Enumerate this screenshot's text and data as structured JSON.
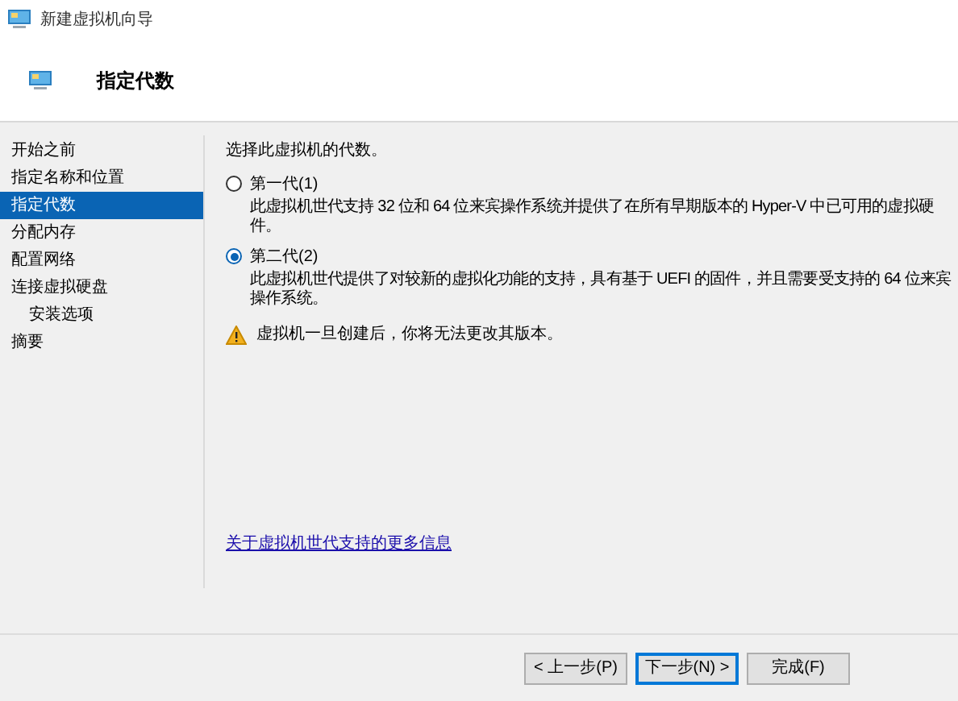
{
  "window": {
    "title": "新建虚拟机向导"
  },
  "header": {
    "title": "指定代数"
  },
  "sidebar": {
    "items": [
      {
        "label": "开始之前",
        "selected": false
      },
      {
        "label": "指定名称和位置",
        "selected": false
      },
      {
        "label": "指定代数",
        "selected": true
      },
      {
        "label": "分配内存",
        "selected": false
      },
      {
        "label": "配置网络",
        "selected": false
      },
      {
        "label": "连接虚拟硬盘",
        "selected": false,
        "children": [
          {
            "label": "安装选项",
            "selected": false
          }
        ]
      },
      {
        "label": "摘要",
        "selected": false
      }
    ]
  },
  "content": {
    "prompt": "选择此虚拟机的代数。",
    "options": [
      {
        "label": "第一代(1)",
        "selected": false,
        "description": "此虚拟机世代支持 32 位和 64 位来宾操作系统并提供了在所有早期版本的 Hyper-V 中已可用的虚拟硬件。"
      },
      {
        "label": "第二代(2)",
        "selected": true,
        "description": "此虚拟机世代提供了对较新的虚拟化功能的支持，具有基于 UEFI 的固件，并且需要受支持的 64 位来宾操作系统。"
      }
    ],
    "warning": "虚拟机一旦创建后，你将无法更改其版本。",
    "link": "关于虚拟机世代支持的更多信息"
  },
  "buttons": [
    {
      "label": "< 上一步(P)",
      "focused": false
    },
    {
      "label": "下一步(N) >",
      "focused": true
    },
    {
      "label": "完成(F)",
      "focused": false
    }
  ]
}
